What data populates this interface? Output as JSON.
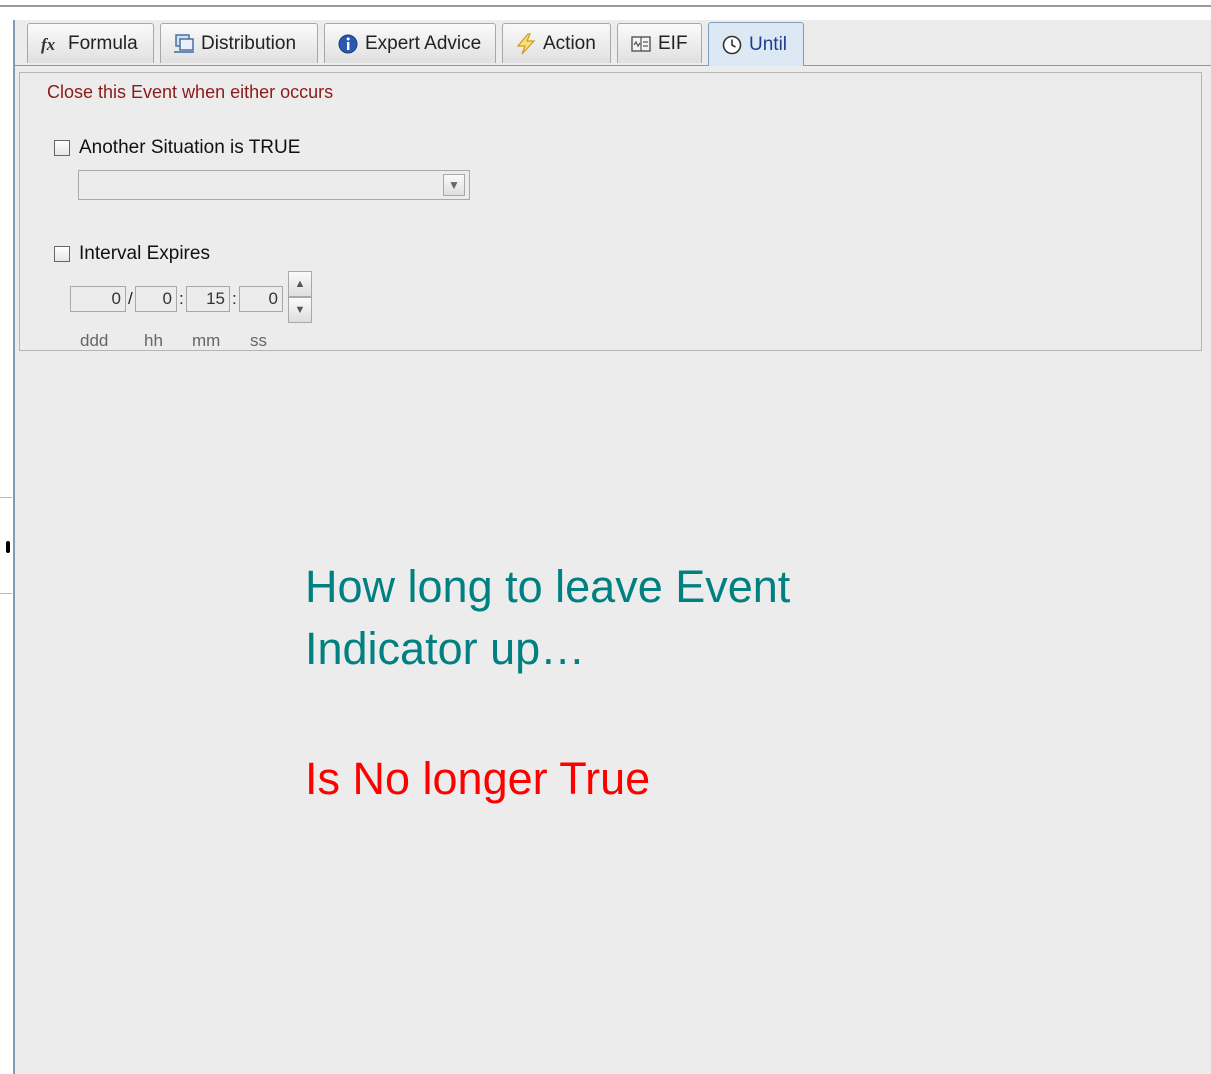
{
  "tabs": [
    {
      "label": "Formula",
      "icon": "fx-icon",
      "active": false
    },
    {
      "label": "Distribution",
      "icon": "distribution-icon",
      "active": false
    },
    {
      "label": "Expert Advice",
      "icon": "info-icon",
      "active": false
    },
    {
      "label": "Action",
      "icon": "lightning-icon",
      "active": false
    },
    {
      "label": "EIF",
      "icon": "eif-icon",
      "active": false
    },
    {
      "label": "Until",
      "icon": "clock-icon",
      "active": true
    }
  ],
  "until": {
    "group_title": "Close this Event when either occurs",
    "another_situation": {
      "label": "Another Situation is TRUE",
      "checked": false,
      "selected": ""
    },
    "interval_expires": {
      "label": "Interval Expires",
      "checked": false
    },
    "interval": {
      "days": "0",
      "hours": "0",
      "minutes": "15",
      "seconds": "0",
      "sep_day": "/",
      "sep_time": ":",
      "units": {
        "days": "ddd",
        "hours": "hh",
        "minutes": "mm",
        "seconds": "ss"
      }
    }
  },
  "annotation": {
    "line1": "How long to leave Event",
    "line2": "Indicator up…",
    "line3": "Is No longer True"
  },
  "colors": {
    "annotation_teal": "#008080",
    "annotation_red": "#ff0000",
    "group_title": "#8b1a1a",
    "active_tab": "#1c3f8e"
  }
}
